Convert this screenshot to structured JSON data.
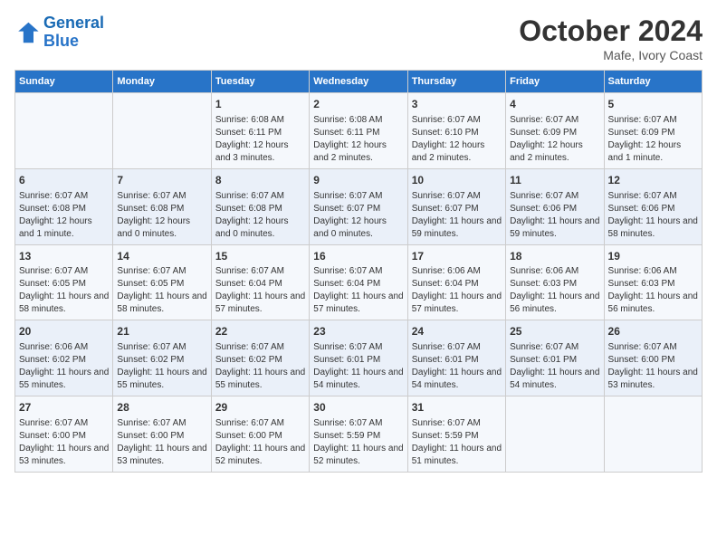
{
  "header": {
    "logo_line1": "General",
    "logo_line2": "Blue",
    "month": "October 2024",
    "location": "Mafe, Ivory Coast"
  },
  "weekdays": [
    "Sunday",
    "Monday",
    "Tuesday",
    "Wednesday",
    "Thursday",
    "Friday",
    "Saturday"
  ],
  "weeks": [
    [
      {
        "day": "",
        "content": ""
      },
      {
        "day": "",
        "content": ""
      },
      {
        "day": "1",
        "content": "Sunrise: 6:08 AM\nSunset: 6:11 PM\nDaylight: 12 hours and 3 minutes."
      },
      {
        "day": "2",
        "content": "Sunrise: 6:08 AM\nSunset: 6:11 PM\nDaylight: 12 hours and 2 minutes."
      },
      {
        "day": "3",
        "content": "Sunrise: 6:07 AM\nSunset: 6:10 PM\nDaylight: 12 hours and 2 minutes."
      },
      {
        "day": "4",
        "content": "Sunrise: 6:07 AM\nSunset: 6:09 PM\nDaylight: 12 hours and 2 minutes."
      },
      {
        "day": "5",
        "content": "Sunrise: 6:07 AM\nSunset: 6:09 PM\nDaylight: 12 hours and 1 minute."
      }
    ],
    [
      {
        "day": "6",
        "content": "Sunrise: 6:07 AM\nSunset: 6:08 PM\nDaylight: 12 hours and 1 minute."
      },
      {
        "day": "7",
        "content": "Sunrise: 6:07 AM\nSunset: 6:08 PM\nDaylight: 12 hours and 0 minutes."
      },
      {
        "day": "8",
        "content": "Sunrise: 6:07 AM\nSunset: 6:08 PM\nDaylight: 12 hours and 0 minutes."
      },
      {
        "day": "9",
        "content": "Sunrise: 6:07 AM\nSunset: 6:07 PM\nDaylight: 12 hours and 0 minutes."
      },
      {
        "day": "10",
        "content": "Sunrise: 6:07 AM\nSunset: 6:07 PM\nDaylight: 11 hours and 59 minutes."
      },
      {
        "day": "11",
        "content": "Sunrise: 6:07 AM\nSunset: 6:06 PM\nDaylight: 11 hours and 59 minutes."
      },
      {
        "day": "12",
        "content": "Sunrise: 6:07 AM\nSunset: 6:06 PM\nDaylight: 11 hours and 58 minutes."
      }
    ],
    [
      {
        "day": "13",
        "content": "Sunrise: 6:07 AM\nSunset: 6:05 PM\nDaylight: 11 hours and 58 minutes."
      },
      {
        "day": "14",
        "content": "Sunrise: 6:07 AM\nSunset: 6:05 PM\nDaylight: 11 hours and 58 minutes."
      },
      {
        "day": "15",
        "content": "Sunrise: 6:07 AM\nSunset: 6:04 PM\nDaylight: 11 hours and 57 minutes."
      },
      {
        "day": "16",
        "content": "Sunrise: 6:07 AM\nSunset: 6:04 PM\nDaylight: 11 hours and 57 minutes."
      },
      {
        "day": "17",
        "content": "Sunrise: 6:06 AM\nSunset: 6:04 PM\nDaylight: 11 hours and 57 minutes."
      },
      {
        "day": "18",
        "content": "Sunrise: 6:06 AM\nSunset: 6:03 PM\nDaylight: 11 hours and 56 minutes."
      },
      {
        "day": "19",
        "content": "Sunrise: 6:06 AM\nSunset: 6:03 PM\nDaylight: 11 hours and 56 minutes."
      }
    ],
    [
      {
        "day": "20",
        "content": "Sunrise: 6:06 AM\nSunset: 6:02 PM\nDaylight: 11 hours and 55 minutes."
      },
      {
        "day": "21",
        "content": "Sunrise: 6:07 AM\nSunset: 6:02 PM\nDaylight: 11 hours and 55 minutes."
      },
      {
        "day": "22",
        "content": "Sunrise: 6:07 AM\nSunset: 6:02 PM\nDaylight: 11 hours and 55 minutes."
      },
      {
        "day": "23",
        "content": "Sunrise: 6:07 AM\nSunset: 6:01 PM\nDaylight: 11 hours and 54 minutes."
      },
      {
        "day": "24",
        "content": "Sunrise: 6:07 AM\nSunset: 6:01 PM\nDaylight: 11 hours and 54 minutes."
      },
      {
        "day": "25",
        "content": "Sunrise: 6:07 AM\nSunset: 6:01 PM\nDaylight: 11 hours and 54 minutes."
      },
      {
        "day": "26",
        "content": "Sunrise: 6:07 AM\nSunset: 6:00 PM\nDaylight: 11 hours and 53 minutes."
      }
    ],
    [
      {
        "day": "27",
        "content": "Sunrise: 6:07 AM\nSunset: 6:00 PM\nDaylight: 11 hours and 53 minutes."
      },
      {
        "day": "28",
        "content": "Sunrise: 6:07 AM\nSunset: 6:00 PM\nDaylight: 11 hours and 53 minutes."
      },
      {
        "day": "29",
        "content": "Sunrise: 6:07 AM\nSunset: 6:00 PM\nDaylight: 11 hours and 52 minutes."
      },
      {
        "day": "30",
        "content": "Sunrise: 6:07 AM\nSunset: 5:59 PM\nDaylight: 11 hours and 52 minutes."
      },
      {
        "day": "31",
        "content": "Sunrise: 6:07 AM\nSunset: 5:59 PM\nDaylight: 11 hours and 51 minutes."
      },
      {
        "day": "",
        "content": ""
      },
      {
        "day": "",
        "content": ""
      }
    ]
  ]
}
